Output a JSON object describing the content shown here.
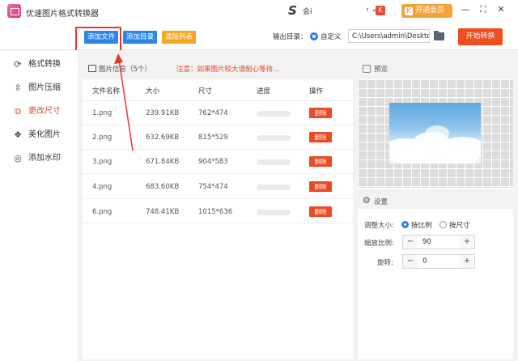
{
  "app": {
    "title": "优速图片格式转换器"
  },
  "tray": {
    "text": "会i",
    "arrows": "› ⌄",
    "badge": "K"
  },
  "header": {
    "vip_label": "开通会员",
    "vip_icon": "K"
  },
  "window": {
    "min": "—",
    "max": "⛶",
    "close": "✕"
  },
  "toolbar": {
    "add_file": "添加文件",
    "add_dir": "添加目录",
    "clear_list": "清除列表",
    "output_label": "输出目录：",
    "output_mode": "自定义",
    "output_path": "C:\\Users\\admin\\Deskto",
    "start": "开始转换",
    "colors": {
      "add_file": "#2b86e8",
      "add_dir": "#2b86e8",
      "clear_list": "#f5a623",
      "start": "#f04c1e"
    }
  },
  "sidebar": {
    "items": [
      {
        "label": "格式转换",
        "icon": "refresh-icon",
        "active": false
      },
      {
        "label": "图片压缩",
        "icon": "compress-icon",
        "active": false
      },
      {
        "label": "更改尺寸",
        "icon": "resize-icon",
        "active": true
      },
      {
        "label": "美化图片",
        "icon": "beautify-icon",
        "active": false
      },
      {
        "label": "添加水印",
        "icon": "watermark-icon",
        "active": false
      }
    ]
  },
  "list": {
    "title": "图片信息（5个）",
    "warning": "注意：如果图片较大请耐心等待...",
    "columns": [
      "文件名称",
      "大小",
      "尺寸",
      "进度",
      "操作"
    ],
    "rows": [
      {
        "name": "1.png",
        "size": "239.91KB",
        "dims": "762*474",
        "action": "删除"
      },
      {
        "name": "2.png",
        "size": "632.69KB",
        "dims": "815*529",
        "action": "删除"
      },
      {
        "name": "3.png",
        "size": "671.84KB",
        "dims": "904*583",
        "action": "删除"
      },
      {
        "name": "4.png",
        "size": "683.60KB",
        "dims": "754*474",
        "action": "删除"
      },
      {
        "name": "6.png",
        "size": "748.41KB",
        "dims": "1015*636",
        "action": "删除"
      }
    ]
  },
  "preview": {
    "title": "预览"
  },
  "settings": {
    "title": "设置",
    "resize_label": "调整大小:",
    "by_ratio": "按比例",
    "by_size": "按尺寸",
    "scale_label": "缩放比例:",
    "scale_value": "90",
    "rotate_label": "旋转:",
    "rotate_value": "0",
    "minus": "−",
    "plus": "+"
  }
}
